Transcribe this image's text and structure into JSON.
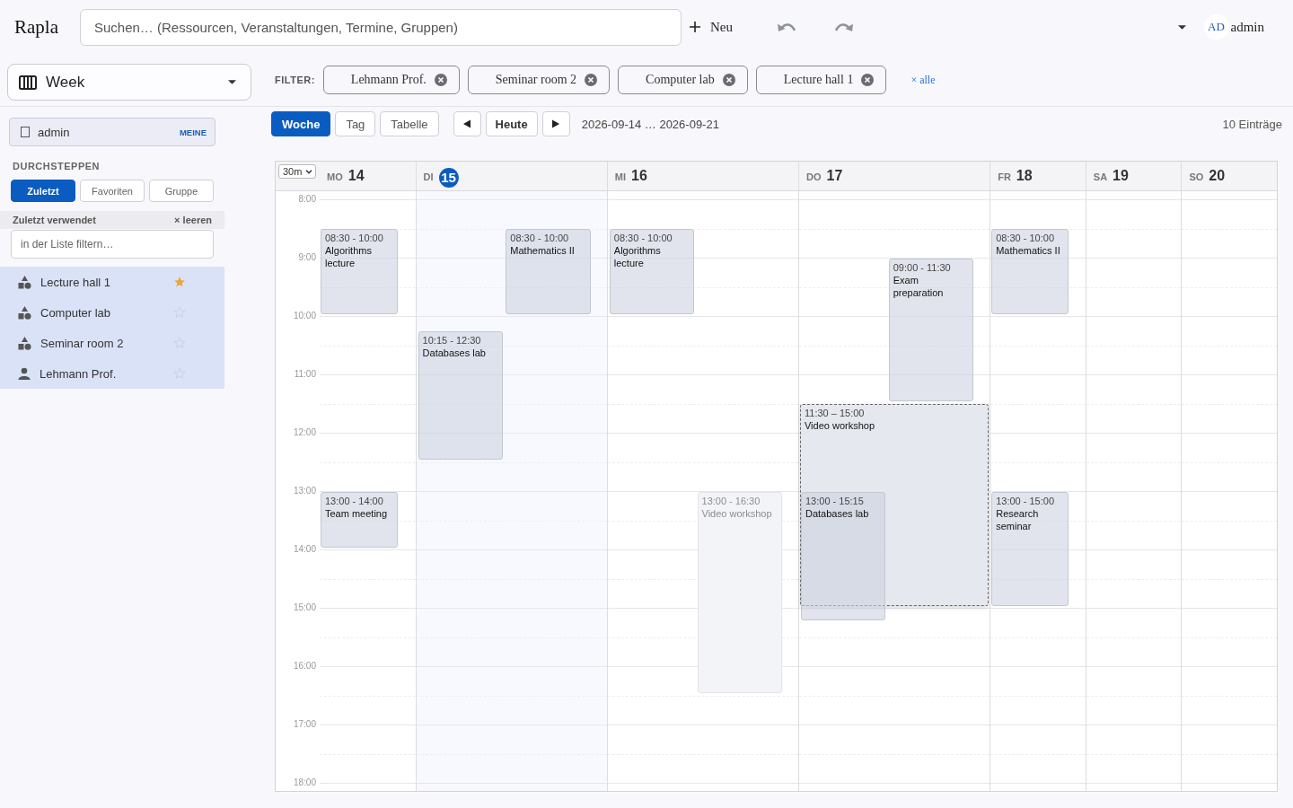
{
  "app": {
    "name": "Rapla"
  },
  "topbar": {
    "search": {
      "placeholder": "Suchen… (Ressourcen, Veranstaltungen, Termine, Gruppen)"
    },
    "new_button": "Neu",
    "user": {
      "initials": "AD",
      "name": "admin"
    }
  },
  "view_select": {
    "value": "Week"
  },
  "filter": {
    "label": "FILTER:",
    "chips": [
      "Lehmann Prof.",
      "Seminar room 2",
      "Computer lab",
      "Lecture hall 1"
    ],
    "clear_all": "× alle"
  },
  "sidebar": {
    "user_box": {
      "checked": false,
      "label": "admin",
      "tag": "MEINE"
    },
    "section_title": "DURCHSTEPPEN",
    "tabs": [
      {
        "label": "Zuletzt",
        "selected": true
      },
      {
        "label": "Favoriten",
        "selected": false
      },
      {
        "label": "Gruppe",
        "selected": false
      }
    ],
    "list_header": {
      "title": "Zuletzt verwendet",
      "clear": "× leeren"
    },
    "list_filter": {
      "placeholder": "in der Liste filtern…"
    },
    "items": [
      {
        "kind": "resource",
        "label": "Lecture hall 1",
        "starred": true,
        "selected": true
      },
      {
        "kind": "resource",
        "label": "Computer lab",
        "starred": false,
        "selected": true
      },
      {
        "kind": "resource",
        "label": "Seminar room 2",
        "starred": false,
        "selected": true
      },
      {
        "kind": "person",
        "label": "Lehmann Prof.",
        "starred": false,
        "selected": true
      }
    ]
  },
  "toolbar": {
    "views": [
      {
        "label": "Woche",
        "selected": true
      },
      {
        "label": "Tag",
        "selected": false
      },
      {
        "label": "Tabelle",
        "selected": false
      }
    ],
    "today_button": "Heute",
    "date_range": "2026-09-14 … 2026-09-21",
    "count": "10 Einträge"
  },
  "calendar": {
    "slot_select": "30m",
    "hours": [
      "8:00",
      "9:00",
      "10:00",
      "11:00",
      "12:00",
      "13:00",
      "14:00",
      "15:00",
      "16:00",
      "17:00",
      "18:00"
    ],
    "days": [
      {
        "weekday": "MO",
        "date": "14",
        "today": false,
        "events": [
          {
            "kind": "event",
            "right_half": false,
            "time": "08:30 - 10:00",
            "title": "Algorithms lecture"
          },
          {
            "kind": "event",
            "right_half": false,
            "time": "13:00 - 14:00",
            "title": "Team meeting"
          }
        ]
      },
      {
        "weekday": "DI",
        "date": "15",
        "today": true,
        "events": [
          {
            "kind": "event",
            "right_half": true,
            "time": "08:30 - 10:00",
            "title": "Mathematics II"
          },
          {
            "kind": "event",
            "right_half": false,
            "time": "10:15 - 12:30",
            "title": "Databases lab"
          }
        ]
      },
      {
        "weekday": "MI",
        "date": "16",
        "today": false,
        "events": [
          {
            "kind": "event",
            "right_half": false,
            "time": "08:30 - 10:00",
            "title": "Algorithms lecture"
          },
          {
            "kind": "faded",
            "right_half": true,
            "time": "13:00 - 16:30",
            "title": "Video workshop"
          }
        ]
      },
      {
        "weekday": "DO",
        "date": "17",
        "today": false,
        "events": [
          {
            "kind": "event",
            "right_half": true,
            "time": "09:00 - 11:30",
            "title": "Exam preparation"
          },
          {
            "kind": "preview",
            "time": "11:30 – 15:00",
            "title": "Video workshop"
          },
          {
            "kind": "event",
            "right_half": false,
            "time": "13:00 - 15:15",
            "title": "Databases lab"
          }
        ]
      },
      {
        "weekday": "FR",
        "date": "18",
        "today": false,
        "events": [
          {
            "kind": "event",
            "right_half": false,
            "time": "08:30 - 10:00",
            "title": "Mathematics II"
          },
          {
            "kind": "event",
            "right_half": false,
            "time": "13:00 - 15:00",
            "title": "Research seminar"
          }
        ]
      },
      {
        "weekday": "SA",
        "date": "19",
        "today": false
      },
      {
        "weekday": "SO",
        "date": "20",
        "today": false
      }
    ]
  }
}
